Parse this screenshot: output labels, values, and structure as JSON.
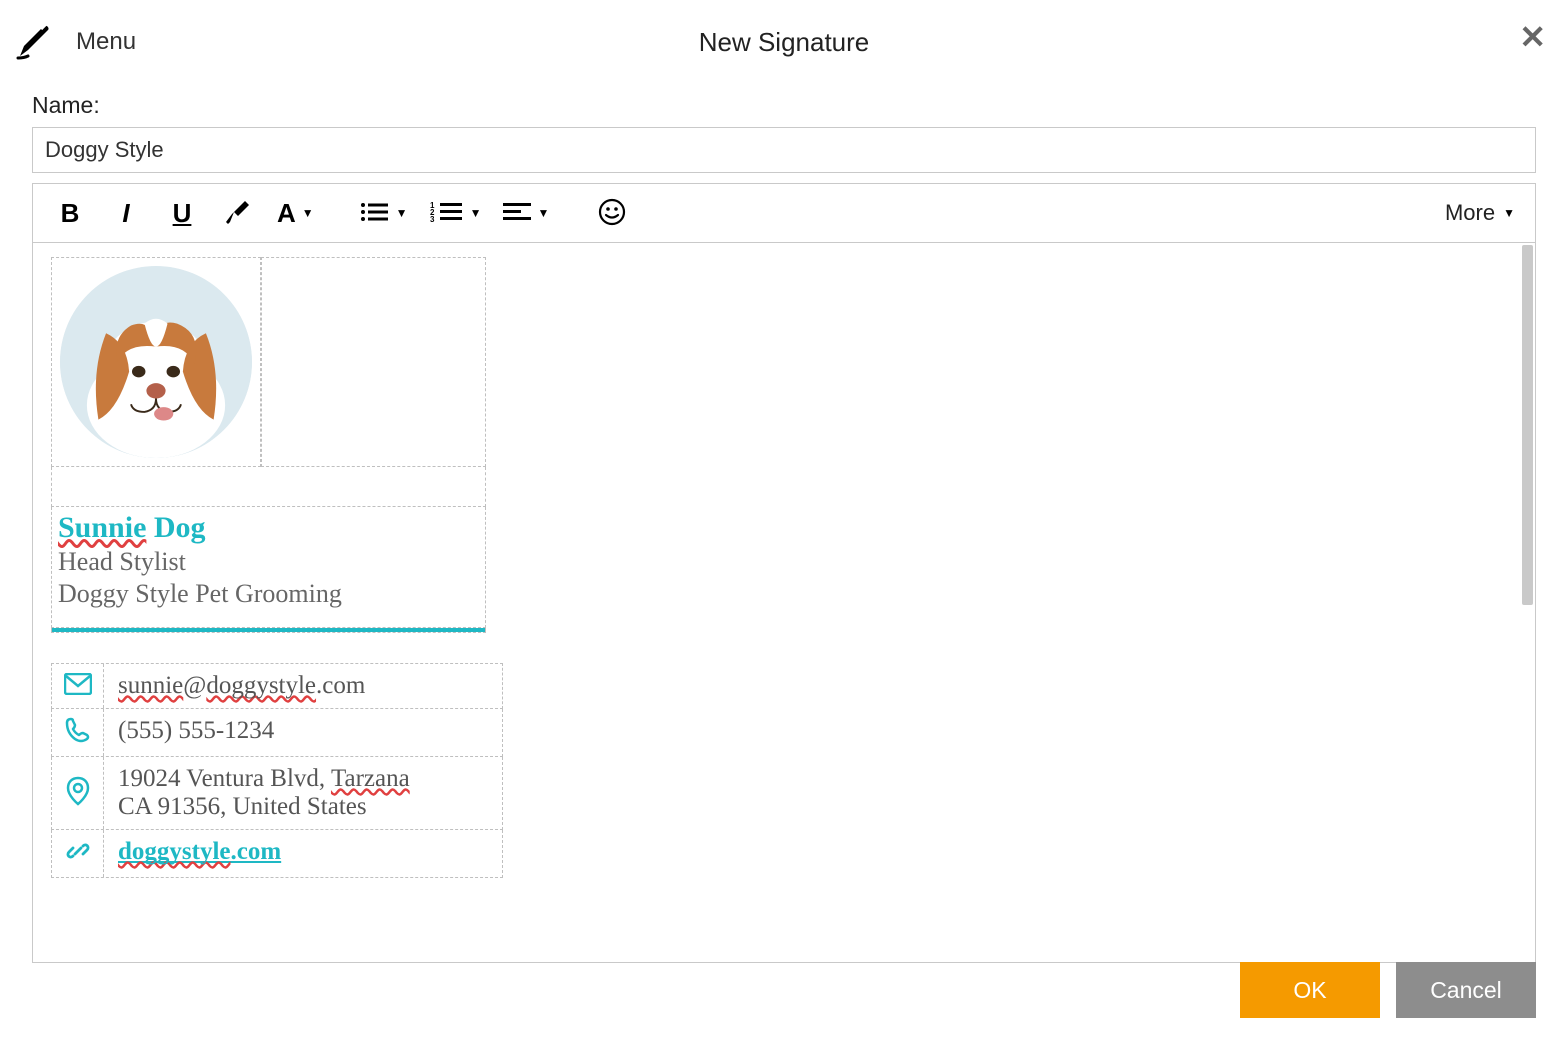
{
  "header": {
    "menu_label": "Menu",
    "title": "New Signature"
  },
  "name_field": {
    "label": "Name:",
    "value": "Doggy Style"
  },
  "toolbar": {
    "more_label": "More"
  },
  "signature": {
    "person_first": "Sunnie",
    "person_last": "Dog",
    "role": "Head Stylist",
    "company": "Doggy Style Pet Grooming",
    "email_user": "sunnie",
    "email_at": "@",
    "email_domain_a": "doggystyle",
    "email_domain_b": ".com",
    "phone": "(555) 555-1234",
    "addr_line1_a": "19024 Ventura Blvd, ",
    "addr_line1_b": "Tarzana",
    "addr_line2": "CA 91356, United States",
    "website_a": "doggystyle",
    "website_b": ".com"
  },
  "buttons": {
    "ok": "OK",
    "cancel": "Cancel"
  }
}
